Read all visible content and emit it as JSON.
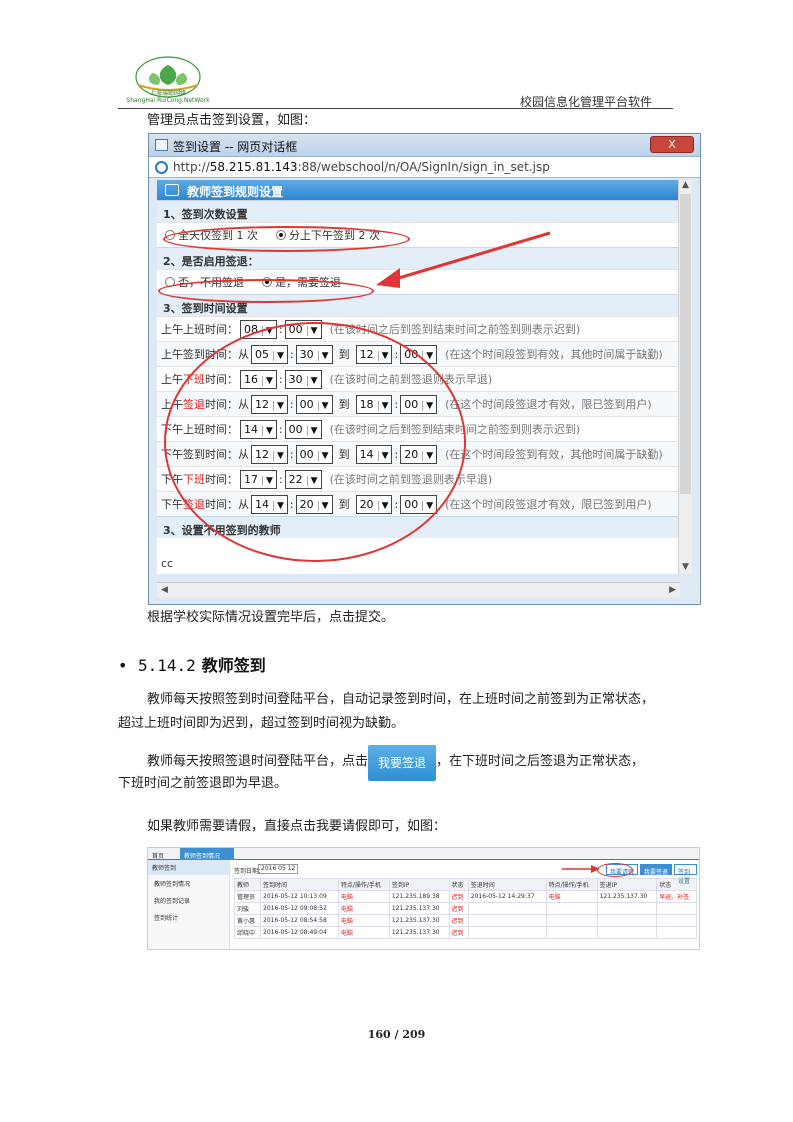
{
  "header": {
    "logo_text_cn": "上海瑞聪网络",
    "logo_text_en": "ShangHai RuiCong.NetWork",
    "right_title": "校园信息化管理平台软件"
  },
  "intro": "管理员点击签到设置，如图：",
  "dialog": {
    "title": "签到设置 -- 网页对话框",
    "close": "X",
    "url_prefix": "http://",
    "url_host": "58.215.81.143",
    "url_rest": ":88/webschool/n/OA/SignIn/sign_in_set.jsp",
    "panel_title": "教师签到规则设置",
    "sec1": "1、签到次数设置",
    "opt1a": "全天仅签到 1 次",
    "opt1b": "分上下午签到 2 次",
    "sec2": "2、是否启用签退：",
    "opt2a": "否，不用签退",
    "opt2b": "是，需要签退",
    "sec3": "3、签到时间设置",
    "rows": [
      {
        "pre": "上午上班时间：",
        "red": "",
        "post": "",
        "from": "",
        "s1": "08",
        "s2": "00",
        "to": "",
        "s3": "",
        "s4": "",
        "hint": "(在该时间之后到签到结束时间之前签到则表示迟到)"
      },
      {
        "pre": "上午签到时间：",
        "red": "",
        "post": "",
        "from": "从",
        "s1": "05",
        "s2": "30",
        "to": "到",
        "s3": "12",
        "s4": "00",
        "hint": "(在这个时间段签到有效，其他时间属于缺勤)"
      },
      {
        "pre": "上午",
        "red": "下班",
        "post": "时间：",
        "from": "",
        "s1": "16",
        "s2": "30",
        "to": "",
        "s3": "",
        "s4": "",
        "hint": "(在该时间之前到签退则表示早退)"
      },
      {
        "pre": "上午",
        "red": "签退",
        "post": "时间：",
        "from": "从",
        "s1": "12",
        "s2": "00",
        "to": "到",
        "s3": "18",
        "s4": "00",
        "hint": "(在这个时间段签退才有效，限已签到用户)"
      },
      {
        "pre": "下午上班时间：",
        "red": "",
        "post": "",
        "from": "",
        "s1": "14",
        "s2": "00",
        "to": "",
        "s3": "",
        "s4": "",
        "hint": "(在该时间之后到签到结束时间之前签到则表示迟到)"
      },
      {
        "pre": "下午签到时间：",
        "red": "",
        "post": "",
        "from": "从",
        "s1": "12",
        "s2": "00",
        "to": "到",
        "s3": "14",
        "s4": "20",
        "hint": "(在这个时间段签到有效，其他时间属于缺勤)"
      },
      {
        "pre": "下午",
        "red": "下班",
        "post": "时间：",
        "from": "",
        "s1": "17",
        "s2": "22",
        "to": "",
        "s3": "",
        "s4": "",
        "hint": "(在该时间之前到签退则表示早退)"
      },
      {
        "pre": "下午",
        "red": "签退",
        "post": "时间：",
        "from": "从",
        "s1": "14",
        "s2": "20",
        "to": "到",
        "s3": "20",
        "s4": "00",
        "hint": "(在这个时间段签退才有效，限已签到用户)"
      }
    ],
    "sec4": "3、设置不用签到的教师",
    "cc": "cc"
  },
  "after_dialog": "根据学校实际情况设置完毕后，点击提交。",
  "section": {
    "bullet": "•",
    "number": "5.14.2",
    "title": "教师签到"
  },
  "p1": "教师每天按照签到时间登陆平台，自动记录签到时间，在上班时间之前签到为正常状态，",
  "p1b": "超过上班时间即为迟到，超过签到时间视为缺勤。",
  "p2a": "教师每天按照签退时间登陆平台，点击",
  "p2_button": "我要签退",
  "p2b": "，在下班时间之后签退为正常状态，",
  "p2c": "下班时间之前签退即为早退。",
  "p3": "如果教师需要请假，直接点击我要请假即可，如图：",
  "shot": {
    "tab_home": "首页",
    "tab_active": "教师签到情况",
    "side_head": "教师签到",
    "side_items": [
      "教师签到情况",
      "我的签到记录",
      "签到统计"
    ],
    "date_label": "签到日期：",
    "date_value": "2016 05 12",
    "btn_leave": "我要请假",
    "btn_signout": "我要签退",
    "btn_settings": "签到设置",
    "headers": [
      "教师",
      "签到时间",
      "特点/操作/手机",
      "签到IP",
      "状态",
      "签退时间",
      "特点/操作/手机",
      "签退IP",
      "状态"
    ],
    "rows": [
      [
        "管理员",
        "2016-05-12 10:13:09",
        "电脑",
        "121.235.189.38",
        "迟到",
        "2016-05-12 14:29:37",
        "电脑",
        "121.235.137.30",
        "早退、补签"
      ],
      [
        "刘骏",
        "2016-05-12 09:08:52",
        "电脑",
        "121.235.137.30",
        "迟到",
        "",
        "",
        "",
        ""
      ],
      [
        "黄小惠",
        "2016-05-12 08:54:58",
        "电脑",
        "121.235.137.30",
        "迟到",
        "",
        "",
        "",
        ""
      ],
      [
        "邱晓中",
        "2016-05-12 08:49:04",
        "电脑",
        "121.235.137.30",
        "迟到",
        "",
        "",
        "",
        ""
      ]
    ]
  },
  "page_number": "160 / 209",
  "colors": {
    "accent_red": "#e03535",
    "panel_blue": "#2f86cf"
  }
}
